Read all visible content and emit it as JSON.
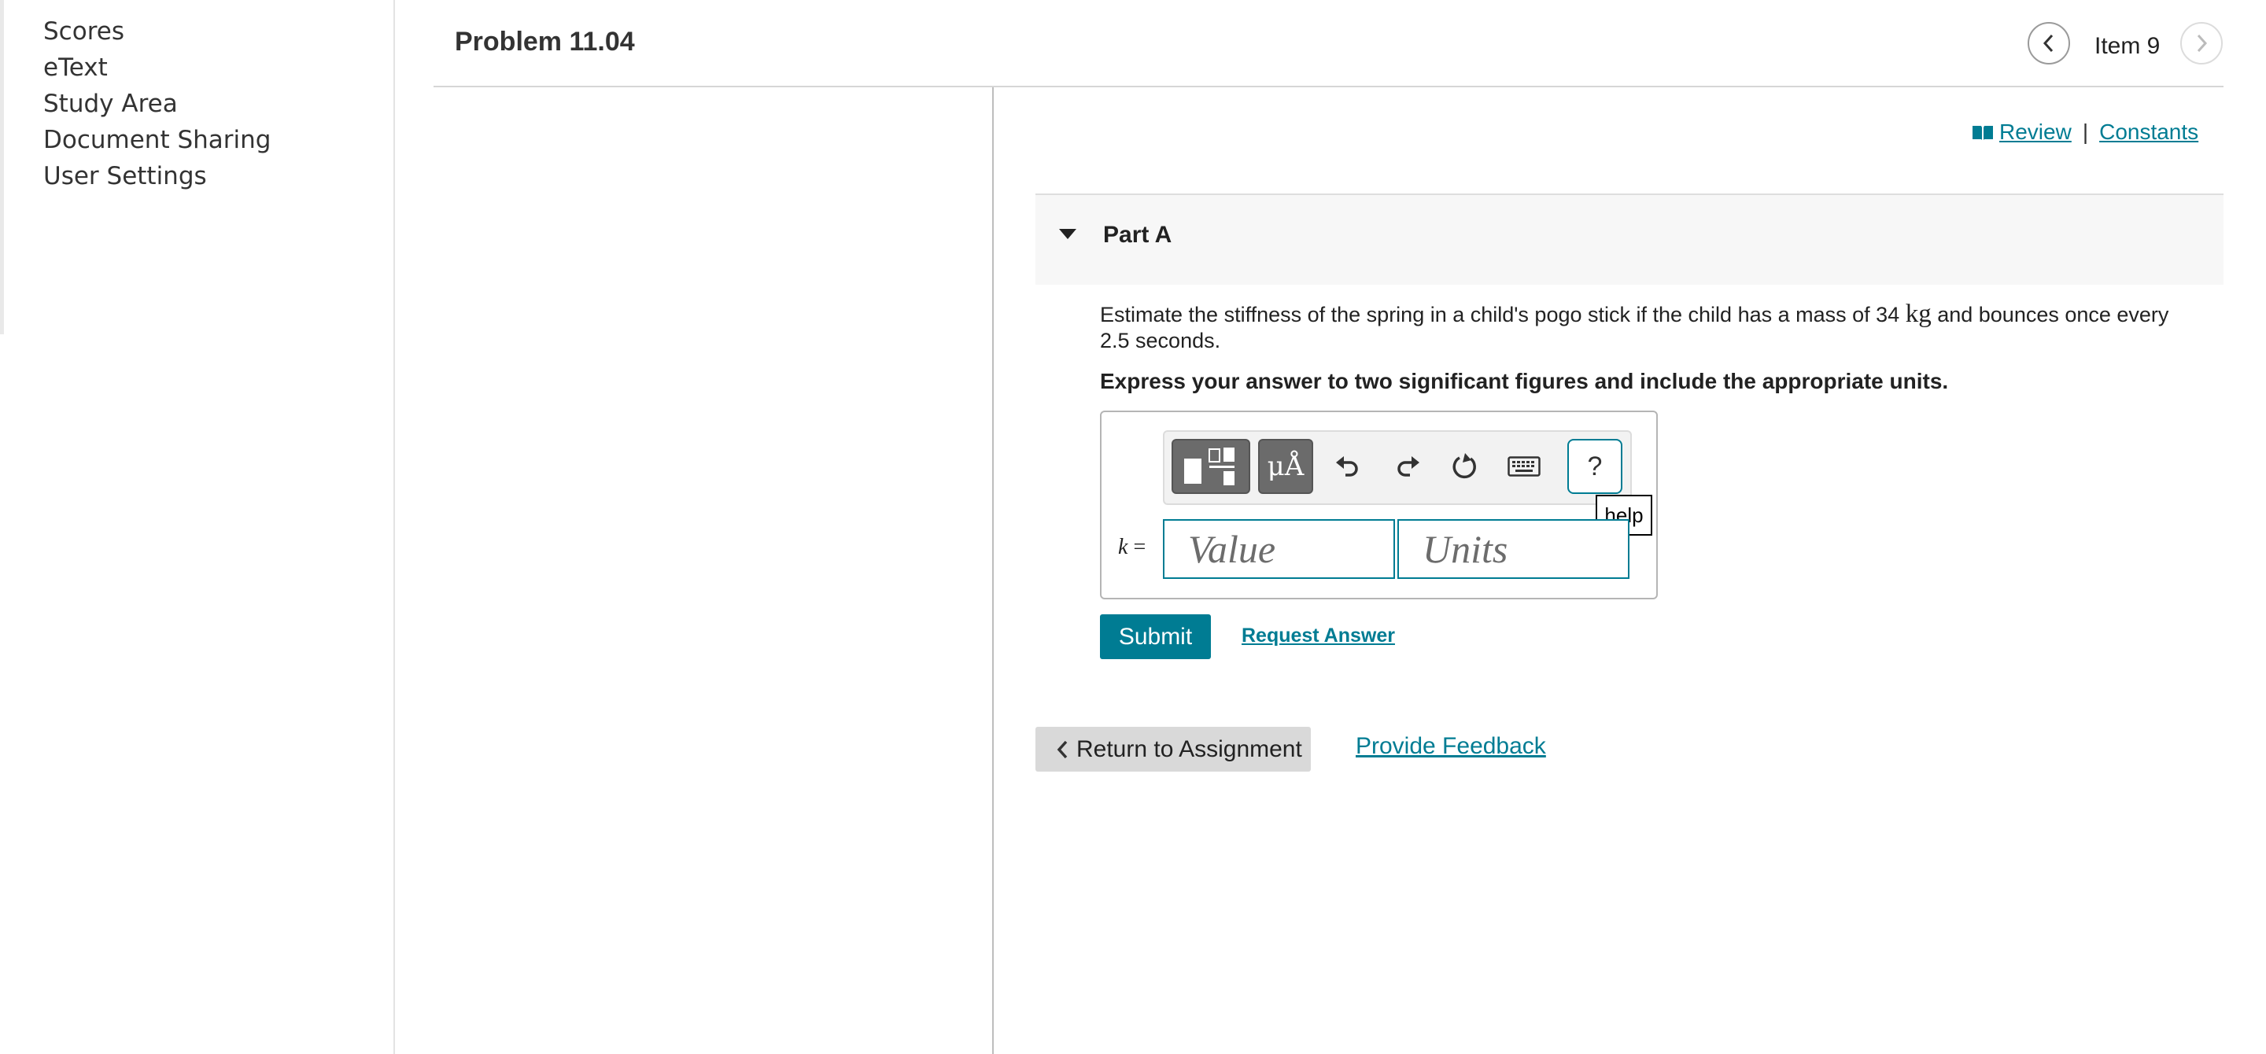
{
  "sidebar": {
    "items": [
      {
        "label": "Scores"
      },
      {
        "label": "eText"
      },
      {
        "label": "Study Area"
      },
      {
        "label": "Document Sharing"
      },
      {
        "label": "User Settings"
      }
    ]
  },
  "header": {
    "title": "Problem 11.04",
    "item_label": "Item 9"
  },
  "links": {
    "review": "Review",
    "separator": "|",
    "constants": "Constants"
  },
  "part": {
    "title": "Part A",
    "question_before": "Estimate the stiffness of the spring in a child's pogo stick if the child has a mass of 34",
    "question_unit": "kg",
    "question_after": "and bounces once every 2.5 seconds.",
    "instructions": "Express your answer to two significant figures and include the appropriate units."
  },
  "answer": {
    "variable": "k",
    "equals": "=",
    "value_placeholder": "Value",
    "units_placeholder": "Units",
    "symbols_label": "μÅ",
    "help_label": "?",
    "tooltip": "help"
  },
  "actions": {
    "submit": "Submit",
    "request_answer": "Request Answer",
    "return": "Return to Assignment",
    "feedback": "Provide Feedback"
  },
  "colors": {
    "accent": "#007c93",
    "toolbar_dark": "#6b6b6b",
    "return_bg": "#d9d9d9"
  }
}
